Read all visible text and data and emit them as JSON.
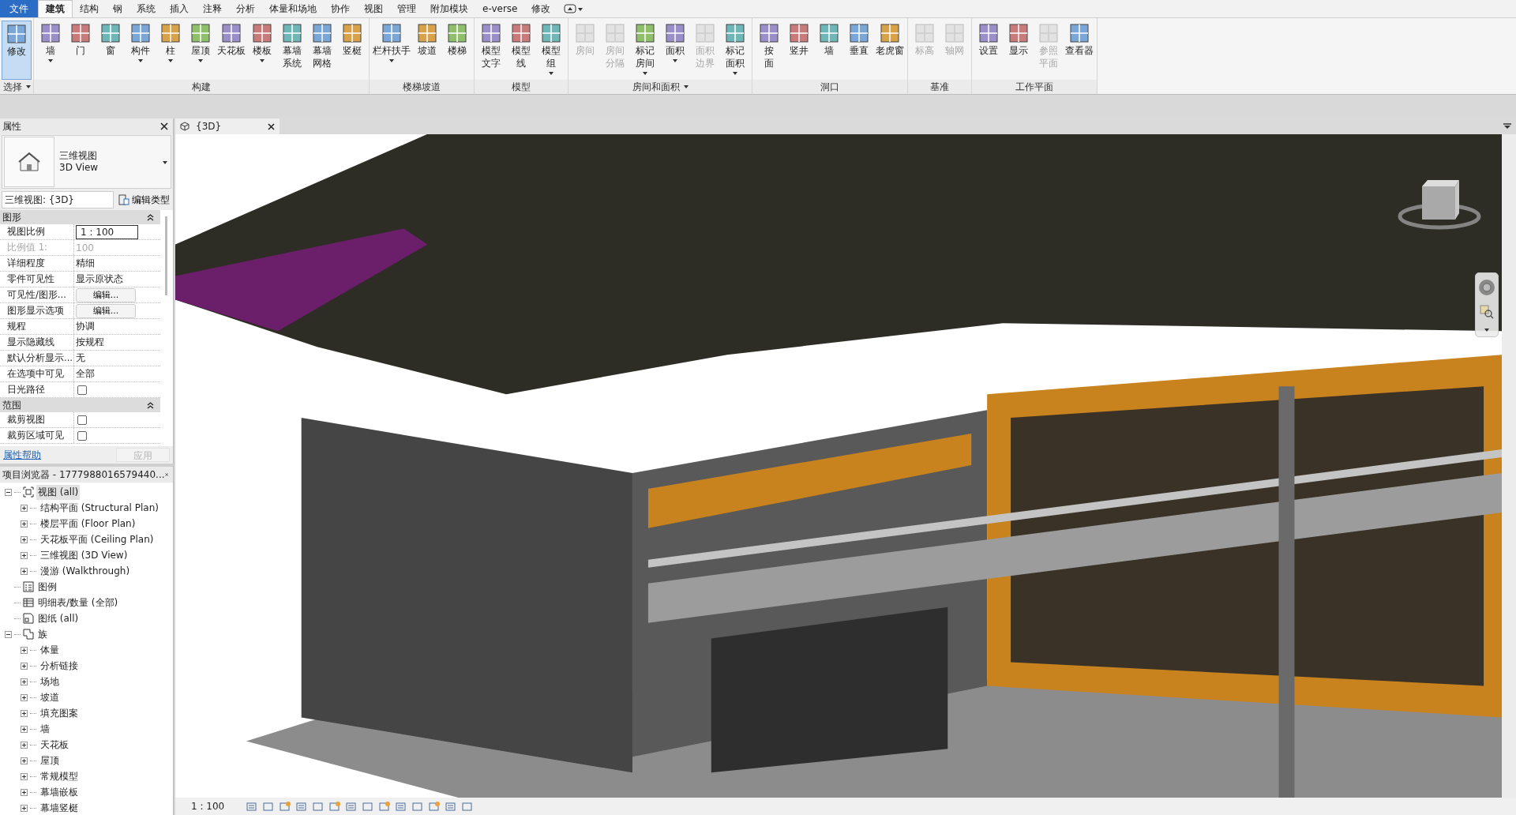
{
  "menu_tabs": [
    {
      "label": "文件",
      "selected": false,
      "kind": "file"
    },
    {
      "label": "建筑",
      "selected": true,
      "kind": "tab"
    },
    {
      "label": "结构",
      "selected": false,
      "kind": "tab"
    },
    {
      "label": "钢",
      "selected": false,
      "kind": "tab"
    },
    {
      "label": "系统",
      "selected": false,
      "kind": "tab"
    },
    {
      "label": "插入",
      "selected": false,
      "kind": "tab"
    },
    {
      "label": "注释",
      "selected": false,
      "kind": "tab"
    },
    {
      "label": "分析",
      "selected": false,
      "kind": "tab"
    },
    {
      "label": "体量和场地",
      "selected": false,
      "kind": "tab"
    },
    {
      "label": "协作",
      "selected": false,
      "kind": "tab"
    },
    {
      "label": "视图",
      "selected": false,
      "kind": "tab"
    },
    {
      "label": "管理",
      "selected": false,
      "kind": "tab"
    },
    {
      "label": "附加模块",
      "selected": false,
      "kind": "tab"
    },
    {
      "label": "e-verse",
      "selected": false,
      "kind": "tab"
    },
    {
      "label": "修改",
      "selected": false,
      "kind": "tab"
    }
  ],
  "ribbon": [
    {
      "title": "选择",
      "menu": true,
      "buttons": [
        {
          "lines": [
            "修改"
          ],
          "selected": true,
          "disabled": false,
          "dropdown": false
        }
      ]
    },
    {
      "title": "构建",
      "buttons": [
        {
          "lines": [
            "墙"
          ],
          "selected": false,
          "disabled": false,
          "dropdown": true
        },
        {
          "lines": [
            "门"
          ],
          "selected": false,
          "disabled": false,
          "dropdown": false
        },
        {
          "lines": [
            "窗"
          ],
          "selected": false,
          "disabled": false,
          "dropdown": false
        },
        {
          "lines": [
            "构件"
          ],
          "selected": false,
          "disabled": false,
          "dropdown": true
        },
        {
          "lines": [
            "柱"
          ],
          "selected": false,
          "disabled": false,
          "dropdown": true
        },
        {
          "lines": [
            "屋顶"
          ],
          "selected": false,
          "disabled": false,
          "dropdown": true
        },
        {
          "lines": [
            "天花板"
          ],
          "selected": false,
          "disabled": false,
          "dropdown": false
        },
        {
          "lines": [
            "楼板"
          ],
          "selected": false,
          "disabled": false,
          "dropdown": true
        },
        {
          "lines": [
            "幕墙",
            "系统"
          ],
          "selected": false,
          "disabled": false,
          "dropdown": false
        },
        {
          "lines": [
            "幕墙",
            "网格"
          ],
          "selected": false,
          "disabled": false,
          "dropdown": false
        },
        {
          "lines": [
            "竖梃"
          ],
          "selected": false,
          "disabled": false,
          "dropdown": false
        }
      ]
    },
    {
      "title": "楼梯坡道",
      "buttons": [
        {
          "lines": [
            "栏杆扶手"
          ],
          "selected": false,
          "disabled": false,
          "dropdown": true
        },
        {
          "lines": [
            "坡道"
          ],
          "selected": false,
          "disabled": false,
          "dropdown": false
        },
        {
          "lines": [
            "楼梯"
          ],
          "selected": false,
          "disabled": false,
          "dropdown": false
        }
      ]
    },
    {
      "title": "模型",
      "buttons": [
        {
          "lines": [
            "模型",
            "文字"
          ],
          "selected": false,
          "disabled": false,
          "dropdown": false
        },
        {
          "lines": [
            "模型",
            "线"
          ],
          "selected": false,
          "disabled": false,
          "dropdown": false
        },
        {
          "lines": [
            "模型",
            "组"
          ],
          "selected": false,
          "disabled": false,
          "dropdown": true
        }
      ]
    },
    {
      "title": "房间和面积",
      "menu": true,
      "buttons": [
        {
          "lines": [
            "房间"
          ],
          "selected": false,
          "disabled": true,
          "dropdown": false
        },
        {
          "lines": [
            "房间",
            "分隔"
          ],
          "selected": false,
          "disabled": true,
          "dropdown": false
        },
        {
          "lines": [
            "标记",
            "房间"
          ],
          "selected": false,
          "disabled": false,
          "dropdown": true
        },
        {
          "lines": [
            "面积"
          ],
          "selected": false,
          "disabled": false,
          "dropdown": true
        },
        {
          "lines": [
            "面积",
            "边界"
          ],
          "selected": false,
          "disabled": true,
          "dropdown": false
        },
        {
          "lines": [
            "标记",
            "面积"
          ],
          "selected": false,
          "disabled": false,
          "dropdown": true
        }
      ]
    },
    {
      "title": "洞口",
      "buttons": [
        {
          "lines": [
            "按",
            "面"
          ],
          "selected": false,
          "disabled": false,
          "dropdown": false
        },
        {
          "lines": [
            "竖井"
          ],
          "selected": false,
          "disabled": false,
          "dropdown": false
        },
        {
          "lines": [
            "墙"
          ],
          "selected": false,
          "disabled": false,
          "dropdown": false
        },
        {
          "lines": [
            "垂直"
          ],
          "selected": false,
          "disabled": false,
          "dropdown": false
        },
        {
          "lines": [
            "老虎窗"
          ],
          "selected": false,
          "disabled": false,
          "dropdown": false
        }
      ]
    },
    {
      "title": "基准",
      "buttons": [
        {
          "lines": [
            "标高"
          ],
          "selected": false,
          "disabled": true,
          "dropdown": false
        },
        {
          "lines": [
            "轴网"
          ],
          "selected": false,
          "disabled": true,
          "dropdown": false
        }
      ]
    },
    {
      "title": "工作平面",
      "buttons": [
        {
          "lines": [
            "设置"
          ],
          "selected": false,
          "disabled": false,
          "dropdown": false
        },
        {
          "lines": [
            "显示"
          ],
          "selected": false,
          "disabled": false,
          "dropdown": false
        },
        {
          "lines": [
            "参照",
            "平面"
          ],
          "selected": false,
          "disabled": true,
          "dropdown": false
        },
        {
          "lines": [
            "查看器"
          ],
          "selected": false,
          "disabled": false,
          "dropdown": false
        }
      ]
    }
  ],
  "properties": {
    "title": "属性",
    "type_name": "三维视图",
    "type_subname": "3D View",
    "instance": "三维视图: {3D}",
    "edit_type": "编辑类型",
    "sections": [
      {
        "title": "图形",
        "expanded": true,
        "rows": [
          {
            "label": "视图比例",
            "value": "1 : 100",
            "kind": "input",
            "disabled": false
          },
          {
            "label": "比例值 1:",
            "value": "100",
            "kind": "text",
            "disabled": true
          },
          {
            "label": "详细程度",
            "value": "精细",
            "kind": "text",
            "disabled": false
          },
          {
            "label": "零件可见性",
            "value": "显示原状态",
            "kind": "text",
            "disabled": false
          },
          {
            "label": "可见性/图形...",
            "value": "编辑...",
            "kind": "button",
            "disabled": false
          },
          {
            "label": "图形显示选项",
            "value": "编辑...",
            "kind": "button",
            "disabled": false
          },
          {
            "label": "规程",
            "value": "协调",
            "kind": "text",
            "disabled": false
          },
          {
            "label": "显示隐藏线",
            "value": "按规程",
            "kind": "text",
            "disabled": false
          },
          {
            "label": "默认分析显示...",
            "value": "无",
            "kind": "text",
            "disabled": false
          },
          {
            "label": "在选项中可见",
            "value": "全部",
            "kind": "text",
            "disabled": false
          },
          {
            "label": "日光路径",
            "checked": false,
            "kind": "checkbox",
            "disabled": false
          }
        ]
      },
      {
        "title": "范围",
        "expanded": true,
        "rows": [
          {
            "label": "裁剪视图",
            "checked": false,
            "kind": "checkbox",
            "disabled": false
          },
          {
            "label": "裁剪区域可见",
            "checked": false,
            "kind": "checkbox",
            "disabled": false
          }
        ]
      }
    ],
    "help": "属性帮助",
    "apply": {
      "label": "应用",
      "disabled": true
    }
  },
  "browser": {
    "title": "项目浏览器 - 1777988016579440...",
    "tree": [
      {
        "label": "视图 (all)",
        "kind": "views",
        "expanded": true,
        "selected": true,
        "children": [
          {
            "label": "结构平面 (Structural Plan)",
            "expanded": false,
            "selected": false
          },
          {
            "label": "楼层平面 (Floor Plan)",
            "expanded": false,
            "selected": false
          },
          {
            "label": "天花板平面 (Ceiling Plan)",
            "expanded": false,
            "selected": false
          },
          {
            "label": "三维视图 (3D View)",
            "expanded": false,
            "selected": false
          },
          {
            "label": "漫游 (Walkthrough)",
            "expanded": false,
            "selected": false
          }
        ]
      },
      {
        "label": "图例",
        "kind": "legend",
        "selected": false
      },
      {
        "label": "明细表/数量 (全部)",
        "kind": "schedule",
        "selected": false
      },
      {
        "label": "图纸 (all)",
        "kind": "sheet",
        "selected": false
      },
      {
        "label": "族",
        "kind": "family",
        "expanded": true,
        "selected": false,
        "children": [
          {
            "label": "体量",
            "expanded": false,
            "selected": false
          },
          {
            "label": "分析链接",
            "expanded": false,
            "selected": false
          },
          {
            "label": "场地",
            "expanded": false,
            "selected": false
          },
          {
            "label": "坡道",
            "expanded": false,
            "selected": false
          },
          {
            "label": "填充图案",
            "expanded": false,
            "selected": false
          },
          {
            "label": "墙",
            "expanded": false,
            "selected": false
          },
          {
            "label": "天花板",
            "expanded": false,
            "selected": false
          },
          {
            "label": "屋顶",
            "expanded": false,
            "selected": false
          },
          {
            "label": "常规模型",
            "expanded": false,
            "selected": false
          },
          {
            "label": "幕墙嵌板",
            "expanded": false,
            "selected": false
          },
          {
            "label": "幕墙竖梃",
            "expanded": false,
            "selected": false
          }
        ]
      }
    ]
  },
  "view_tab": {
    "label": "{3D}"
  },
  "status_bar": {
    "scale": "1 : 100"
  }
}
